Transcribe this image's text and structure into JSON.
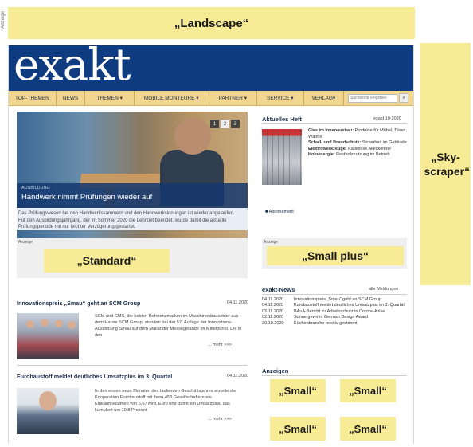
{
  "vertical_label": "Anzeige",
  "ads": {
    "landscape": "„Landscape“",
    "skyscraper": "„Sky-scraper“",
    "standard": "„Standard“",
    "small_plus": "„Small plus“",
    "small": [
      "„Small“",
      "„Small“",
      "„Small“",
      "„Small“"
    ],
    "anzeige_label": "Anzeige",
    "anzeigen_heading": "Anzeigen"
  },
  "site": {
    "logo": "exakt",
    "nav": [
      "TOP-THEMEN",
      "NEWS",
      "THEMEN ▾",
      "MOBILE MONTEURE ▾",
      "PARTNER ▾",
      "SERVICE ▾",
      "VERLAG▾"
    ],
    "search_placeholder": "Suchworte eingeben",
    "search_icon": "magnifier-icon"
  },
  "hero": {
    "kicker": "AUSBILDUNG",
    "title": "Handwerk nimmt Prüfungen wieder auf",
    "pager": [
      "1",
      "2",
      "3"
    ],
    "teaser": "Das Prüfungswesen bei den Handwerkskammern und den Handwerksinnungen ist wieder angelaufen. Für den Ausbildungsjahrgang, der im Sommer 2020 die Lehrzeit beendet, wurde damit die aktuelle Prüfungsperiode mit nur leichter Verzögerung gestartet."
  },
  "heft": {
    "heading": "Aktuelles Heft",
    "issue": "exakt 10-2020",
    "items": [
      {
        "bold": "Glas im Innenausbau:",
        "text": " Produkte für Möbel, Türen, Wände"
      },
      {
        "bold": "Schall- und Brandschutz:",
        "text": " Sicherheit im Gebäude"
      },
      {
        "bold": "Elektrowerkzeuge:",
        "text": " Kabellose Alleskönner"
      },
      {
        "bold": "Holoenergie:",
        "text": " Restholznutzung im Betrieb"
      }
    ],
    "abo": "Abonnement"
  },
  "news_list": {
    "heading": "exakt-News",
    "all_link": "alle Meldungen",
    "items": [
      {
        "date": "04.11.2020",
        "text": "Innovationspreis „Smau“ geht an SCM Group"
      },
      {
        "date": "04.11.2020",
        "text": "Eurobaustoff meldet deutliches Umsatzplus im 3. Quartal"
      },
      {
        "date": "03.11.2020",
        "text": "BAuA-Bericht zu Arbeitsschutz in Corona-Krise"
      },
      {
        "date": "02.11.2020",
        "text": "Sonae gewinnt German Design Award"
      },
      {
        "date": "30.10.2020",
        "text": "Küchenbranche positiv gestimmt"
      }
    ]
  },
  "articles": [
    {
      "title": "Innovationspreis „Smau“ geht an SCM Group",
      "date": "04.11.2020",
      "text": "SCM und CMS, die beiden Referenzmarken im Maschinenbausektor aus dem Hause SCM Group, standen bei der 57. Auflage der Innovations-Ausstellung Smau auf dem Mailänder Messegelände im Mittelpunkt. Die in den",
      "more": "... mehr >>>"
    },
    {
      "title": "Eurobaustoff meldet deutliches Umsatzplus im 3. Quartal",
      "date": "04.11.2020",
      "text": "In den ersten neun Monaten des laufenden Geschäftsjahres erzielte die Kooperation Eurobaustoff mit ihren 453 Gesellschaftern ein Einkaufsvolumen von 5,67 Mrd. Euro und damit ein Umsatzplus, das kumuliert um 10,8 Prozent",
      "more": "... mehr >>>"
    }
  ]
}
